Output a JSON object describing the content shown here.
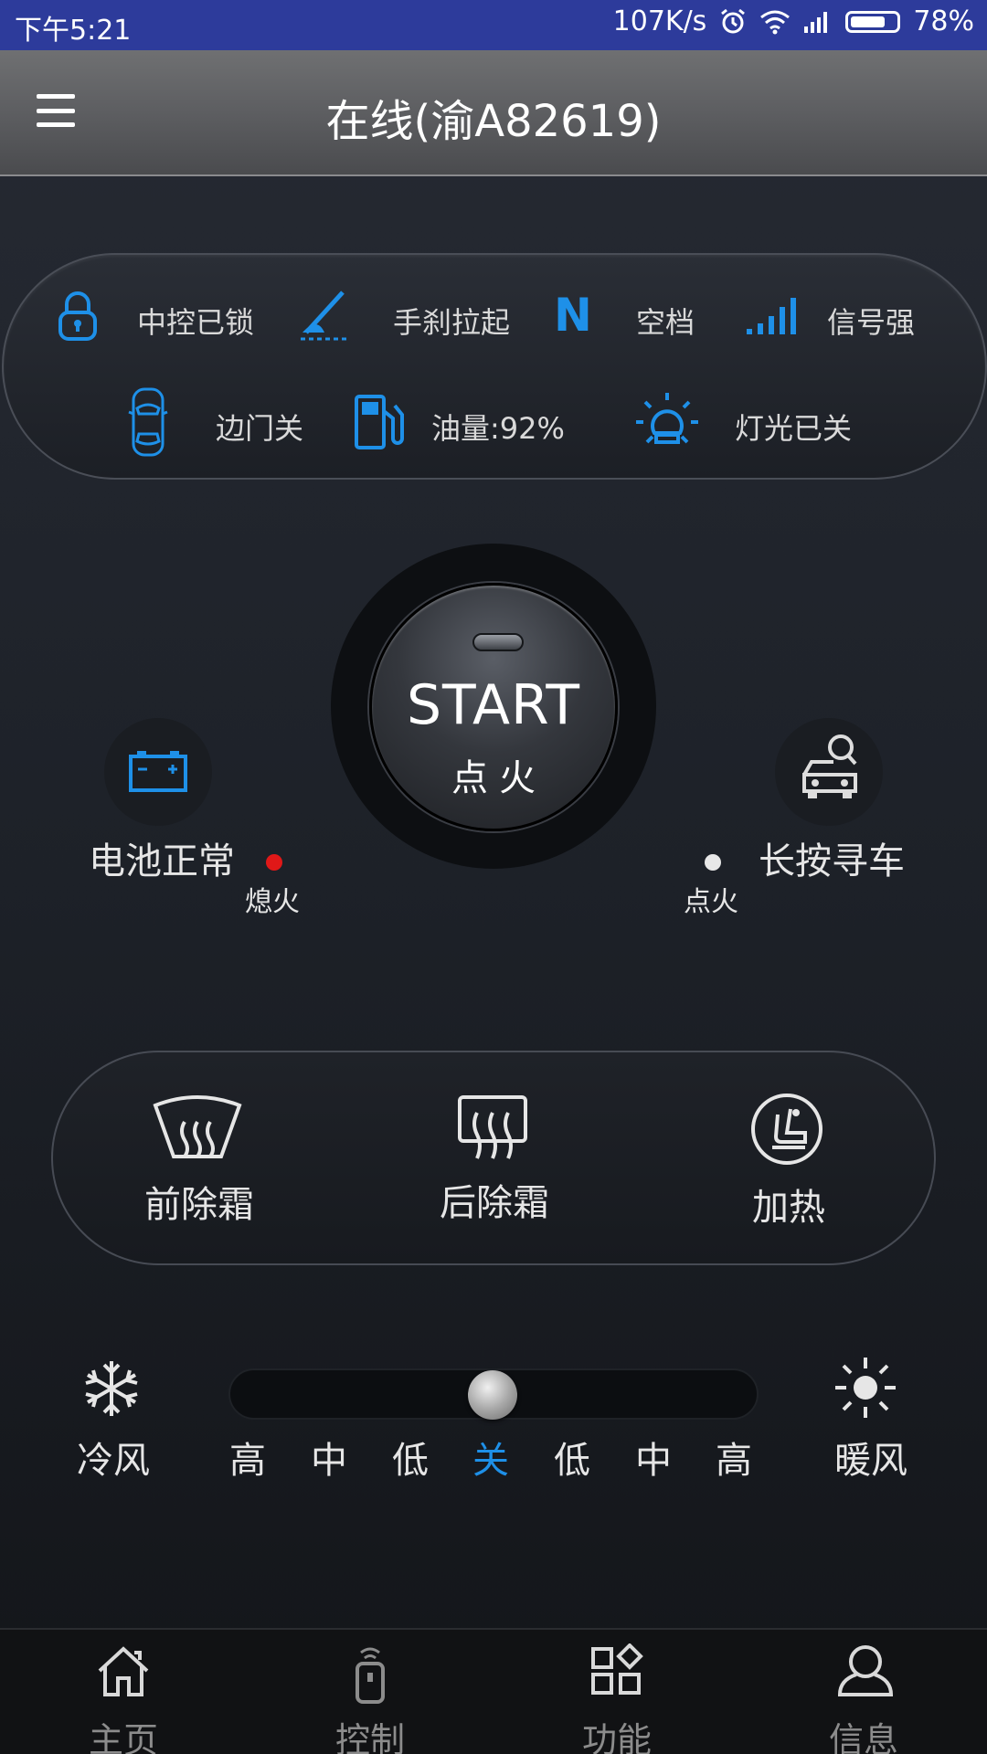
{
  "status_bar": {
    "time": "下午5:21",
    "speed": "107K/s",
    "battery": "78%",
    "battery_level": 0.78
  },
  "header": {
    "title": "在线(渝A82619)"
  },
  "vehicle_status": {
    "lock": "中控已锁",
    "handbrake": "手刹拉起",
    "gear_letter": "N",
    "gear": "空档",
    "signal": "信号强",
    "door": "边门关",
    "fuel": "油量:92%",
    "lights": "灯光已关"
  },
  "engine": {
    "start_en": "START",
    "start_cn": "点火"
  },
  "battery_status": {
    "label": "电池正常"
  },
  "find_car": {
    "label": "长按寻车"
  },
  "indicators": {
    "off_label": "熄火",
    "on_label": "点火",
    "off_color": "#e01818",
    "on_color": "#e8e8e8"
  },
  "comfort": {
    "front_defrost": "前除霜",
    "rear_defrost": "后除霜",
    "heating": "加热"
  },
  "fan": {
    "cool": "冷风",
    "warm": "暖风",
    "levels": [
      "高",
      "中",
      "低",
      "关",
      "低",
      "中",
      "高"
    ],
    "selected_index": 3
  },
  "nav": {
    "home": "主页",
    "control": "控制",
    "functions": "功能",
    "info": "信息"
  },
  "colors": {
    "accent": "#1e90e8",
    "status_bar": "#2d3b9b"
  }
}
